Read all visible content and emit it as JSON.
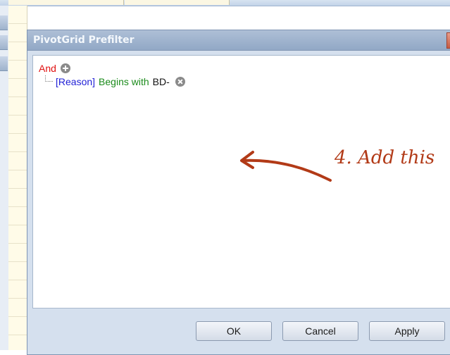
{
  "dialog": {
    "title": "PivotGrid Prefilter",
    "close_glyph": "✕",
    "buttons": {
      "ok_label": "OK",
      "cancel_label": "Cancel",
      "apply_label": "Apply"
    }
  },
  "filter": {
    "group_operator": "And",
    "add_icon": "plus-circle-icon",
    "condition": {
      "field": "[Reason]",
      "operator": "Begins with",
      "value": "BD-",
      "remove_icon": "remove-circle-icon"
    }
  },
  "annotation": {
    "text": "4. Add this",
    "color": "#b23a17"
  }
}
